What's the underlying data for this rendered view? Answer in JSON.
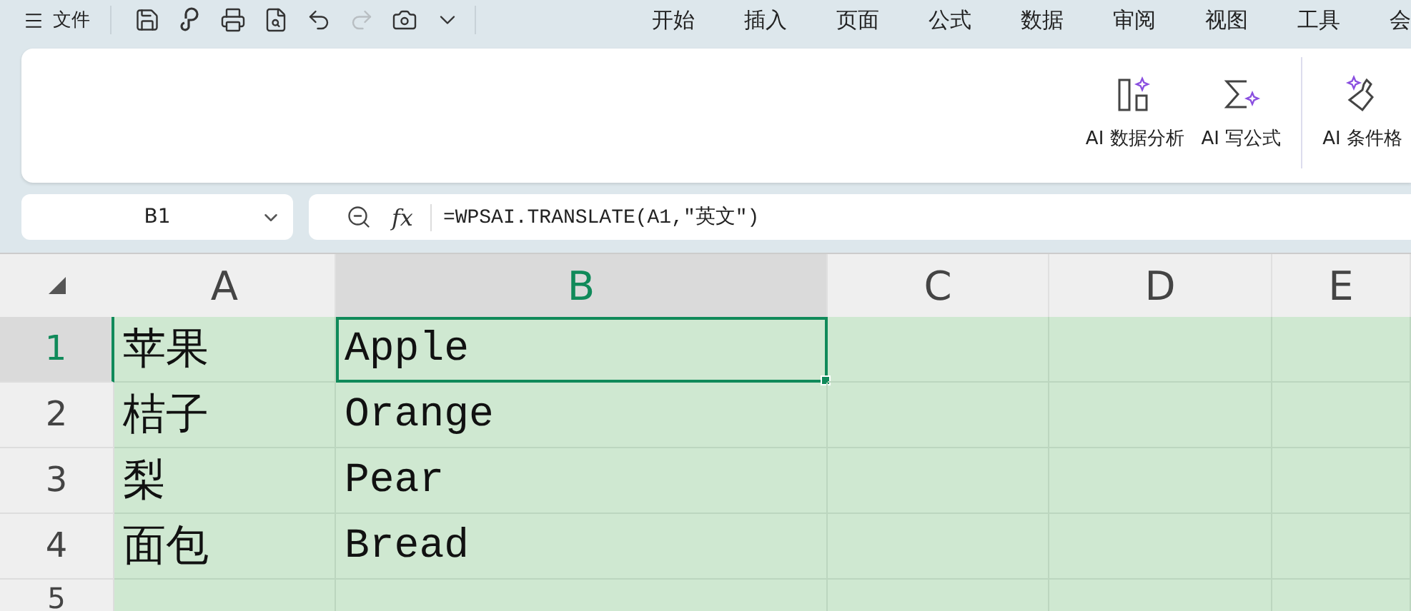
{
  "title_bar": {
    "menu_label": "文件",
    "quick_actions": [
      {
        "kind": "save",
        "disabled": false
      },
      {
        "kind": "hook",
        "disabled": false
      },
      {
        "kind": "print",
        "disabled": false
      },
      {
        "kind": "preview",
        "disabled": false
      },
      {
        "kind": "undo",
        "disabled": false
      },
      {
        "kind": "redo",
        "disabled": true
      },
      {
        "kind": "camera",
        "disabled": false
      },
      {
        "kind": "more",
        "disabled": false
      }
    ],
    "tabs": [
      "开始",
      "插入",
      "页面",
      "公式",
      "数据",
      "审阅",
      "视图",
      "工具",
      "会"
    ]
  },
  "ribbon": {
    "buttons": [
      {
        "kind": "analysis",
        "label": "AI 数据分析"
      },
      {
        "kind": "formula",
        "label": "AI 写公式"
      },
      {
        "kind": "brush",
        "label": "AI 条件格"
      }
    ]
  },
  "formula_bar": {
    "name_box": "B1",
    "fx": "fx",
    "formula": "=WPSAI.TRANSLATE(A1,\"英文\")"
  },
  "sheet": {
    "columns": [
      {
        "label": "A",
        "selected": false
      },
      {
        "label": "B",
        "selected": true
      },
      {
        "label": "C",
        "selected": false
      },
      {
        "label": "D",
        "selected": false
      },
      {
        "label": "E",
        "selected": false
      }
    ],
    "rows": [
      {
        "label": "1",
        "selected": true,
        "cells": [
          "苹果",
          "Apple",
          "",
          "",
          ""
        ]
      },
      {
        "label": "2",
        "selected": false,
        "cells": [
          "桔子",
          "Orange",
          "",
          "",
          ""
        ]
      },
      {
        "label": "3",
        "selected": false,
        "cells": [
          "梨",
          "Pear",
          "",
          "",
          ""
        ]
      },
      {
        "label": "4",
        "selected": false,
        "cells": [
          "面包",
          "Bread",
          "",
          "",
          ""
        ]
      },
      {
        "label": "5",
        "selected": false,
        "cells": [
          "",
          "",
          "",
          "",
          ""
        ]
      }
    ]
  }
}
